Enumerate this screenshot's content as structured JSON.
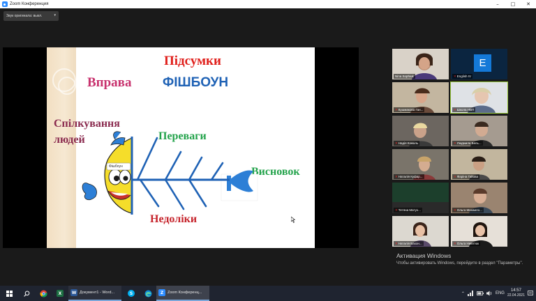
{
  "window": {
    "title": "Zoom Конференция",
    "controls": [
      "–",
      "□",
      "✕"
    ]
  },
  "toolbar": {
    "audio_dropdown": "Звук оригинала: выкл."
  },
  "slide": {
    "title_summary": "Підсумки",
    "title_exercise": "Вправа",
    "title_fishbone": "ФІШБОУН",
    "topic_line1": "Спілкування",
    "topic_line2": "людей",
    "advantages": "Переваги",
    "conclusion": "Висновок",
    "disadvantages": "Недоліки",
    "fish_tag": "Фішбоун",
    "colors": {
      "red": "#e0201c",
      "blue": "#1f62b5",
      "magenta": "#c8326e",
      "purple": "#8a2a4e",
      "green": "#23a34b",
      "darkred": "#c6242c",
      "fish_yellow": "#f5dd2a",
      "fish_blue": "#2d7fd6"
    }
  },
  "gallery": [
    {
      "name": "Nina Sophiuk",
      "bg": "#cfc9c2",
      "muted": false
    },
    {
      "name": "English IV",
      "bg": "#0b2540",
      "muted": true,
      "avatar_letter": "E",
      "avatar_color": "#1479d8"
    },
    {
      "name": "Кушмакова Ган...",
      "bg": "#b8a48c",
      "muted": true
    },
    {
      "name": "Школа НВП",
      "bg": "#c9ccd1",
      "muted": true,
      "active": true
    },
    {
      "name": "Надія Кожаль",
      "bg": "#5a5a5a",
      "muted": true
    },
    {
      "name": "Людмила Бель...",
      "bg": "#9a8f86",
      "muted": true
    },
    {
      "name": "Наталія Куфар...",
      "bg": "#6e6a63",
      "muted": true
    },
    {
      "name": "Фаріна Гайова",
      "bg": "#b9ae98",
      "muted": true
    },
    {
      "name": "Тетяна Матух...",
      "bg": "#173b2a",
      "muted": true
    },
    {
      "name": "Ольга Михаило...",
      "bg": "#8e7763",
      "muted": true
    },
    {
      "name": "Наталія Бахон...",
      "bg": "#d2cfc8",
      "muted": true
    },
    {
      "name": "Ольга Никитюк",
      "bg": "#e1dbd3",
      "muted": true
    }
  ],
  "activation": {
    "heading": "Активация Windows",
    "text": "Чтобы активировать Windows, перейдите в раздел \"Параметры\"."
  },
  "taskbar": {
    "apps": [
      {
        "label": "Документ1 - Word...",
        "icon": "W",
        "color": "#2b5797"
      },
      {
        "label": "Zoom Конференц...",
        "icon": "Z",
        "color": "#2d8cff",
        "active": true
      }
    ],
    "lang": "ENG",
    "time": "14:57",
    "date": "22.04.2021"
  }
}
